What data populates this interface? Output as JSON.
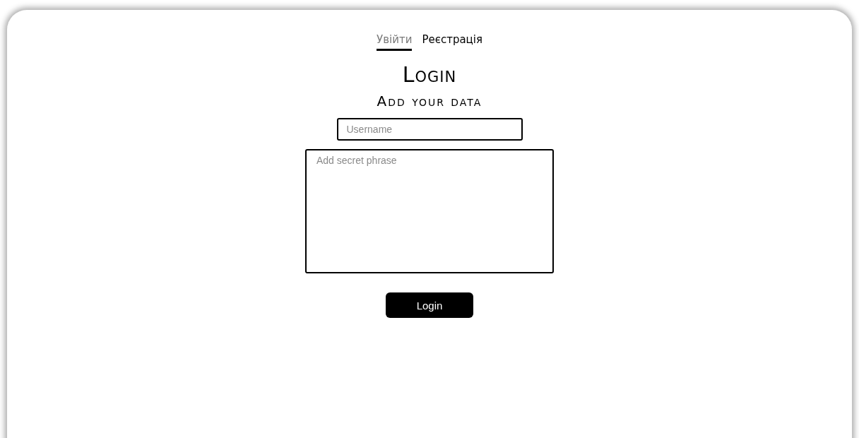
{
  "tabs": [
    {
      "label": "Увійти",
      "selected": true
    },
    {
      "label": "Реєстрація",
      "selected": false
    }
  ],
  "title": "Login",
  "subtitle": "Add your data",
  "username": {
    "placeholder": "Username"
  },
  "secret": {
    "placeholder": "Add secret phrase"
  },
  "button": "Login"
}
